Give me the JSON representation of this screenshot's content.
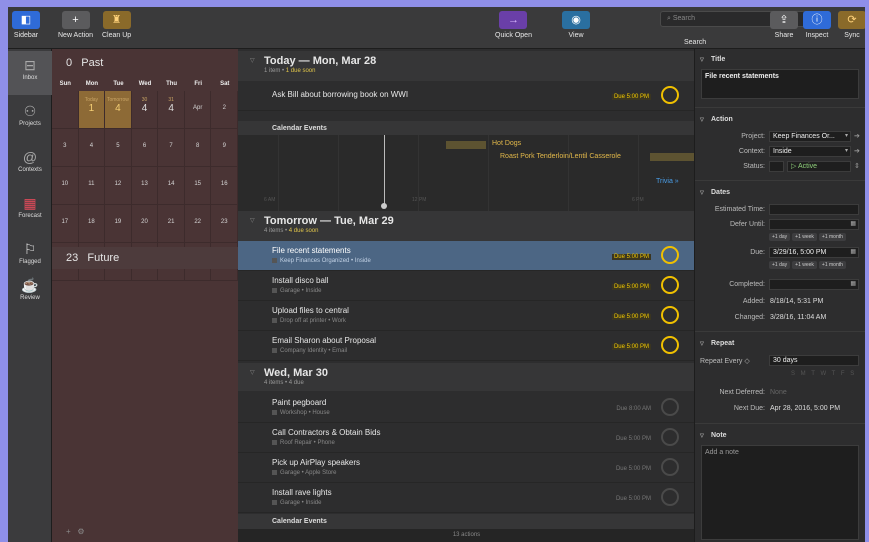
{
  "toolbar": {
    "sidebar": "Sidebar",
    "new_action": "New Action",
    "clean_up": "Clean Up",
    "quick_open": "Quick Open",
    "view": "View",
    "search_placeholder": "Search",
    "search_label": "Search",
    "share": "Share",
    "inspect": "Inspect",
    "sync": "Sync"
  },
  "sidebar": {
    "items": [
      {
        "label": "Inbox",
        "icon": "inbox-icon"
      },
      {
        "label": "Projects",
        "icon": "projects-icon"
      },
      {
        "label": "Contexts",
        "icon": "contexts-icon"
      },
      {
        "label": "Forecast",
        "icon": "forecast-icon"
      },
      {
        "label": "Flagged",
        "icon": "flag-icon"
      },
      {
        "label": "Review",
        "icon": "review-icon"
      }
    ]
  },
  "calendar": {
    "past_count": "0",
    "past_label": "Past",
    "future_count": "23",
    "future_label": "Future",
    "days_of_week": [
      "Sun",
      "Mon",
      "Tue",
      "Wed",
      "Thu",
      "Fri",
      "Sat"
    ],
    "weeks": [
      [
        {
          "d": "",
          "sub": ""
        },
        {
          "d": "1",
          "sub": "Today",
          "hl": true,
          "big": true
        },
        {
          "d": "4",
          "sub": "Tomorrow",
          "hl": true,
          "big": true
        },
        {
          "d": "4",
          "sub": "30",
          "big": true
        },
        {
          "d": "4",
          "sub": "31",
          "big": true
        },
        {
          "d": "Apr",
          "sub": ""
        },
        {
          "d": "2",
          "sub": ""
        }
      ],
      [
        {
          "d": "3"
        },
        {
          "d": "4"
        },
        {
          "d": "5"
        },
        {
          "d": "6"
        },
        {
          "d": "7"
        },
        {
          "d": "8"
        },
        {
          "d": "9"
        }
      ],
      [
        {
          "d": "10"
        },
        {
          "d": "11"
        },
        {
          "d": "12"
        },
        {
          "d": "13"
        },
        {
          "d": "14"
        },
        {
          "d": "15"
        },
        {
          "d": "16"
        }
      ],
      [
        {
          "d": "17"
        },
        {
          "d": "18"
        },
        {
          "d": "19"
        },
        {
          "d": "20"
        },
        {
          "d": "21"
        },
        {
          "d": "22"
        },
        {
          "d": "23"
        }
      ],
      [
        {
          "d": "24"
        },
        {
          "d": "25"
        },
        {
          "d": "26"
        },
        {
          "d": "27"
        },
        {
          "d": "28"
        },
        {
          "d": "29"
        },
        {
          "d": "30"
        }
      ]
    ]
  },
  "main": {
    "today": {
      "title": "Today — Mon, Mar 28",
      "count": "1 item",
      "soon": "1 due soon"
    },
    "today_task": {
      "title": "Ask Bill about borrowing book on WWI",
      "due": "Due 5:00 PM"
    },
    "calendar_events_label": "Calendar Events",
    "events": [
      "Hot Dogs",
      "Roast Pork Tenderloin/Lentil Casserole"
    ],
    "trivia": "Trivia »",
    "tick_noon": "12 PM",
    "tick_6pm": "6 PM",
    "tick_6am": "6 AM",
    "tomorrow": {
      "title": "Tomorrow — Tue, Mar 29",
      "count": "4 items",
      "soon": "4 due soon"
    },
    "tomorrow_tasks": [
      {
        "title": "File recent statements",
        "meta": "Keep Finances Organized • Inside",
        "due": "Due 5:00 PM"
      },
      {
        "title": "Install disco ball",
        "meta": "Garage • Inside",
        "due": "Due 5:00 PM"
      },
      {
        "title": "Upload files to central",
        "meta": "Drop off at printer • Work",
        "due": "Due 5:00 PM"
      },
      {
        "title": "Email Sharon about Proposal",
        "meta": "Company Identity • Email",
        "due": "Due 5:00 PM"
      }
    ],
    "wed": {
      "title": "Wed, Mar 30",
      "count": "4 items • 4 due"
    },
    "wed_tasks": [
      {
        "title": "Paint pegboard",
        "meta": "Workshop • House",
        "due": "Due 8:00 AM"
      },
      {
        "title": "Call Contractors & Obtain Bids",
        "meta": "Roof Repair • Phone",
        "due": "Due 5:00 PM"
      },
      {
        "title": "Pick up AirPlay speakers",
        "meta": "Garage • Apple Store",
        "due": "Due 5:00 PM"
      },
      {
        "title": "Install rave lights",
        "meta": "Garage • Inside",
        "due": "Due 5:00 PM"
      }
    ],
    "status": "13 actions"
  },
  "inspector": {
    "title_head": "Title",
    "title_value": "File recent statements",
    "action_head": "Action",
    "project_label": "Project:",
    "project_value": "Keep Finances Or...",
    "context_label": "Context:",
    "context_value": "Inside",
    "status_label": "Status:",
    "status_value": "Active",
    "dates_head": "Dates",
    "est_label": "Estimated Time:",
    "defer_label": "Defer Until:",
    "plus_day": "+1 day",
    "plus_week": "+1 week",
    "plus_month": "+1 month",
    "due_label": "Due:",
    "due_value": "3/29/16, 5:00 PM",
    "completed_label": "Completed:",
    "added_label": "Added:",
    "added_value": "8/18/14, 5:31 PM",
    "changed_label": "Changed:",
    "changed_value": "3/28/16, 11:04 AM",
    "repeat_head": "Repeat",
    "repeat_every": "Repeat Every ◇",
    "repeat_value": "30 days",
    "weekdays": "S M T W T F S",
    "next_deferred_label": "Next Deferred:",
    "next_deferred_value": "None",
    "next_due_label": "Next Due:",
    "next_due_value": "Apr 28, 2016, 5:00 PM",
    "note_head": "Note",
    "note_placeholder": "Add a note"
  },
  "colors": {
    "accent_yellow": "#f0c000",
    "selection": "#4c6684",
    "calendar_bg": "#4a3435",
    "forecast_red": "#e24b5b"
  }
}
